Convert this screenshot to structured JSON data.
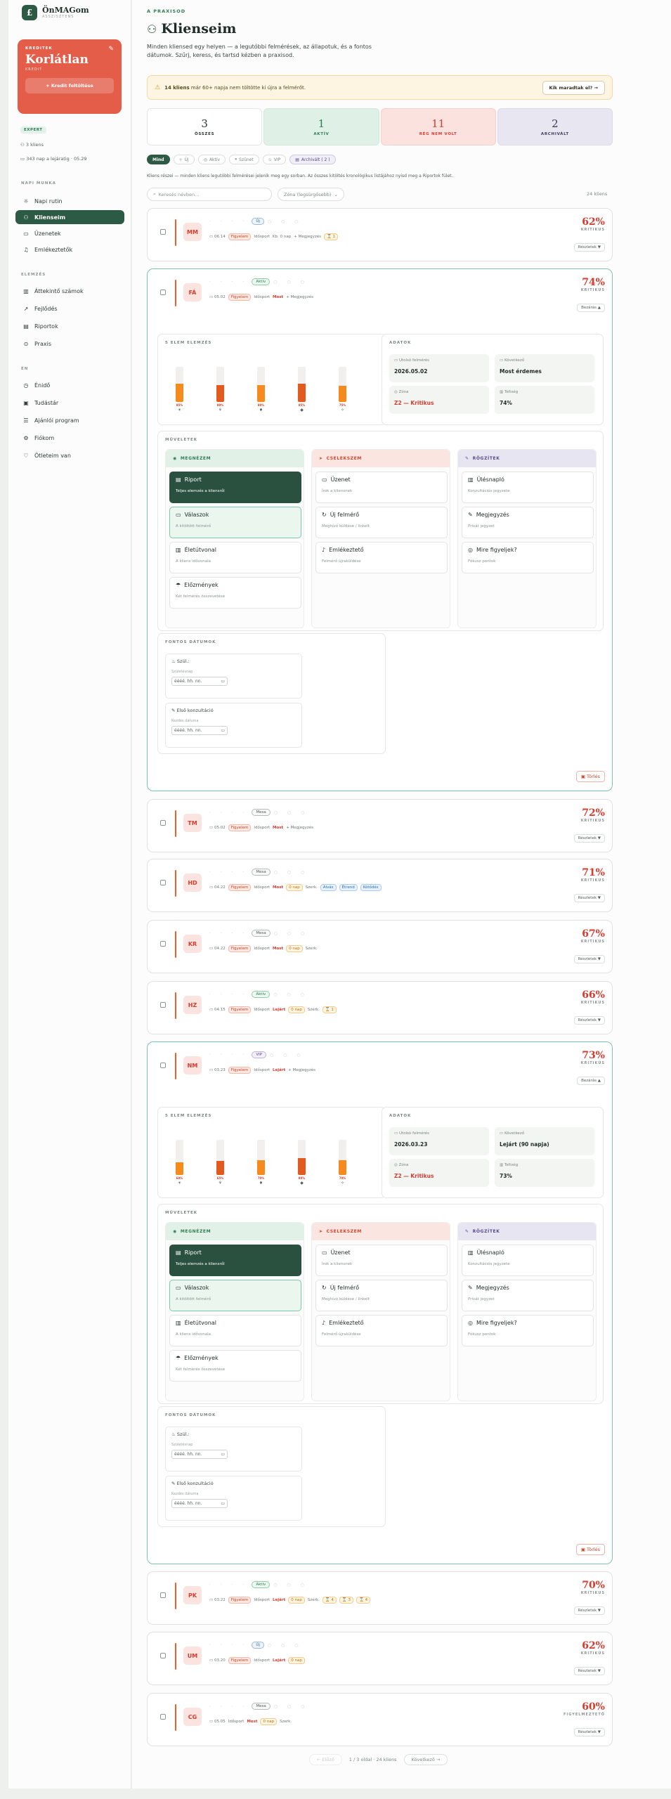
{
  "sidebar": {
    "brand": {
      "name": "ÖnMAGom",
      "sub": "ASSZISZTENS",
      "mark": "£"
    },
    "credit": {
      "label": "KREDITEK",
      "value": "Korlátlan",
      "sub": "KREDIT",
      "button": "+ Kredit feltöltése"
    },
    "tier": "EXPERT",
    "clients": "3 kliens",
    "days": "343 nap a lejáratig · 05.29",
    "sections": [
      {
        "title": "NAPI MUNKA",
        "items": [
          "Napi rutin",
          "Klienseim",
          "Üzenetek",
          "Emlékeztetők"
        ]
      },
      {
        "title": "ELEMZÉS",
        "items": [
          "Áttekintő számok",
          "Fejlődés",
          "Riportok",
          "Praxis"
        ]
      },
      {
        "title": "ÉN",
        "items": [
          "Énidő",
          "Tudástár",
          "Ajánlói program",
          "Fiókom",
          "Ötleteim van"
        ]
      }
    ]
  },
  "page": {
    "eyebrow": "A PRAXISOD",
    "title": "Klienseim",
    "lead": "Minden kliensed egy helyen — a legutóbbi felmérések, az állapotuk, és a fontos dátumok. Szűrj, keress, és tartsd kézben a praxisod."
  },
  "warning": {
    "strong": "14 kliens",
    "text": "már 60+ napja nem töltötte ki újra a felmérőt.",
    "button": "Kik maradtak el? →"
  },
  "stats": [
    {
      "value": "3",
      "label": "ÖSSZES"
    },
    {
      "value": "1",
      "label": "AKTÍV"
    },
    {
      "value": "11",
      "label": "RÉG NEM VOLT"
    },
    {
      "value": "2",
      "label": "ARCHIVÁLT"
    }
  ],
  "filters": [
    "Mind",
    "Új",
    "Aktív",
    "Szünet",
    "VIP",
    "Archivált ( 2 )"
  ],
  "hint": "Kliens részei — minden kliens legutóbbi felmérései jelenik meg egy sorban. Az összes kitöltés kronológikus listájához nyisd meg a Riportok fület.",
  "search": {
    "placeholder": "Keresés névben..."
  },
  "sort": {
    "value": "Zóna (legsürgősebb)"
  },
  "count": "24 kliens",
  "common": {
    "details": "Részletek ▼",
    "details_open": "Bezárás ▲",
    "five_title": "5 ELEM ELEMZÉS",
    "data_title": "ADATOK",
    "actions_title": "MŰVELETEK",
    "dates_title": "FONTOS DÁTUMOK",
    "delete": "Törlés",
    "cols": [
      {
        "title": "MEGNÉZEM",
        "items": [
          {
            "t": "Riport",
            "d": "Teljes elemzés a kliensről"
          },
          {
            "t": "Válaszok",
            "d": "A kitöltött felmérő"
          },
          {
            "t": "Életútvonal",
            "d": "A kliens idővonala"
          },
          {
            "t": "Előzmények",
            "d": "Két felmérés összevetése"
          }
        ]
      },
      {
        "title": "CSELEKSZEM",
        "items": [
          {
            "t": "Üzenet",
            "d": "Írok a kliensnek"
          },
          {
            "t": "Új felmérő",
            "d": "Meghívó küldése / linkelt"
          },
          {
            "t": "Emlékeztető",
            "d": "Felmérő újraküldése"
          }
        ]
      },
      {
        "title": "RÖGZÍTEK",
        "items": [
          {
            "t": "Ülésnapló",
            "d": "Konzultációs jegyzete"
          },
          {
            "t": "Megjegyzés",
            "d": "Privát jegyzet"
          },
          {
            "t": "Mire figyeljek?",
            "d": "Fókusz pontok"
          }
        ]
      }
    ],
    "dates": [
      {
        "t": "Szül.:",
        "k": "Születésnap",
        "v": "éééé. hh. nn."
      },
      {
        "t": "Első konzultáció",
        "k": "Kezdés dátuma",
        "v": "éééé. hh. nn."
      }
    ],
    "data_keys": [
      "Utolsó felmérés",
      "Következő",
      "Zóna",
      "Teltség"
    ]
  },
  "clients": [
    {
      "initials": "MM",
      "status": "Új",
      "status_kind": "uj",
      "date": "06.14",
      "score": "62%",
      "zone": "KRITIKUS",
      "meta": [
        "Figyelem",
        "Idősport",
        "Kb. 0 nap",
        "+ Megjegyzés",
        "⌛ 1"
      ]
    },
    {
      "initials": "FÁ",
      "status": "Aktív",
      "status_kind": "aktiv",
      "date": "05.02",
      "score": "74%",
      "zone": "KRITIKUS",
      "meta": [
        "Figyelem",
        "Idősport",
        "Most",
        "+ Megjegyzés"
      ],
      "open": true,
      "bars": [
        {
          "v": "85%",
          "p": 85
        },
        {
          "v": "80%",
          "p": 80
        },
        {
          "v": "80%",
          "p": 80
        },
        {
          "v": "85%",
          "p": 85
        },
        {
          "v": "75%",
          "p": 75
        }
      ],
      "data": [
        "2026.05.02",
        "Most érdemes",
        "Z2 — Kritikus",
        "74%"
      ]
    },
    {
      "initials": "TM",
      "status": "Mesa",
      "status_kind": "",
      "date": "05.02",
      "score": "72%",
      "zone": "KRITIKUS",
      "meta": [
        "Figyelem",
        "Idősport",
        "Most",
        "+ Megjegyzés"
      ]
    },
    {
      "initials": "HD",
      "status": "Mesa",
      "status_kind": "",
      "date": "04.22",
      "score": "71%",
      "zone": "KRITIKUS",
      "meta": [
        "Figyelem",
        "Idősport",
        "Most",
        "0 nap",
        "Szerk.",
        "Alvás",
        "Étrend",
        "Kötődés"
      ]
    },
    {
      "initials": "KR",
      "status": "Mesa",
      "status_kind": "",
      "date": "04.22",
      "score": "67%",
      "zone": "KRITIKUS",
      "meta": [
        "Figyelem",
        "Idősport",
        "Most",
        "0 nap",
        "Szerk."
      ]
    },
    {
      "initials": "HZ",
      "status": "Aktív",
      "status_kind": "aktiv",
      "date": "04.15",
      "score": "66%",
      "zone": "KRITIKUS",
      "meta": [
        "Figyelem",
        "Idősport",
        "Lejárt",
        "0 nap",
        "Szerk.",
        "⌛ 1"
      ]
    },
    {
      "initials": "NM",
      "status": "VIP",
      "status_kind": "vip",
      "date": "03.23",
      "score": "73%",
      "zone": "KRITIKUS",
      "meta": [
        "Figyelem",
        "Idősport",
        "Lejárt",
        "+ Megjegyzés"
      ],
      "open": true,
      "bars": [
        {
          "v": "60%",
          "p": 60
        },
        {
          "v": "65%",
          "p": 65
        },
        {
          "v": "70%",
          "p": 70
        },
        {
          "v": "80%",
          "p": 80
        },
        {
          "v": "70%",
          "p": 70
        }
      ],
      "data": [
        "2026.03.23",
        "Lejárt (90 napja)",
        "Z2 — Kritikus",
        "73%"
      ]
    },
    {
      "initials": "PK",
      "status": "Aktív",
      "status_kind": "aktiv",
      "date": "03.22",
      "score": "70%",
      "zone": "KRITIKUS",
      "meta": [
        "Figyelem",
        "Idősport",
        "Lejárt",
        "0 nap",
        "Szerk.",
        "⌛ 4",
        "⌛ 3",
        "⌛ 4"
      ]
    },
    {
      "initials": "UM",
      "status": "Új",
      "status_kind": "uj",
      "date": "03.20",
      "score": "62%",
      "zone": "KRITIKUS",
      "meta": [
        "Figyelem",
        "Idősport",
        "Lejárt",
        "0 nap"
      ]
    },
    {
      "initials": "CG",
      "status": "Mesa",
      "status_kind": "",
      "date": "05.05",
      "score": "60%",
      "zone": "FIGYELMEZTETŐ",
      "meta": [
        "Idősport",
        "Most",
        "0 nap",
        "Szerk."
      ]
    }
  ],
  "pagination": {
    "prev": "← Előző",
    "info": "1 / 3 oldal · 24 kliens",
    "next": "Következő →"
  }
}
